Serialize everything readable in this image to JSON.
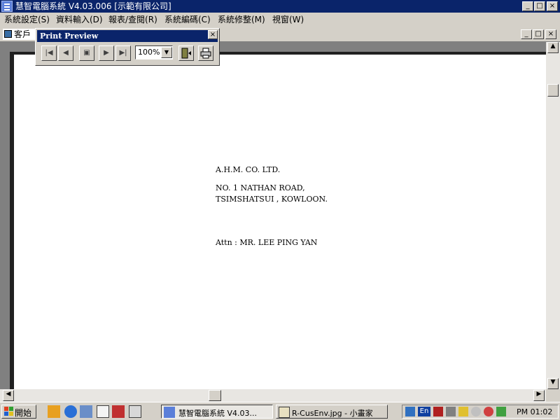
{
  "window": {
    "title": "慧智電腦系統 V4.03.006 [示範有限公司]"
  },
  "menu": [
    {
      "label": "系統設定(S)"
    },
    {
      "label": "資料輸入(D)"
    },
    {
      "label": "報表/查閱(R)"
    },
    {
      "label": "系統編碼(C)"
    },
    {
      "label": "系統修整(M)"
    },
    {
      "label": "視窗(W)"
    }
  ],
  "child_window": {
    "title": "客戶"
  },
  "print_preview": {
    "title": "Print Preview",
    "zoom": "100%",
    "buttons": [
      "first-page",
      "previous-page",
      "multi-page",
      "next-page",
      "last-page",
      "exit",
      "print"
    ]
  },
  "document": {
    "company": "A.H.M. CO. LTD.",
    "address_line1": "NO. 1 NATHAN ROAD,",
    "address_line2": "TSIMSHATSUI , KOWLOON.",
    "attn": "Attn : MR. LEE PING YAN"
  },
  "taskbar": {
    "start_label": "開始",
    "tasks": [
      {
        "label": "慧智電腦系統 V4.03...",
        "active": true
      },
      {
        "label": "R-CusEnv.jpg - 小畫家",
        "active": false
      }
    ],
    "tray": {
      "lang": "En",
      "clock": "PM 01:02"
    }
  },
  "colors": {
    "titlebar": "#0a246a",
    "face": "#d4d0c8",
    "desktop_gray": "#808080"
  }
}
